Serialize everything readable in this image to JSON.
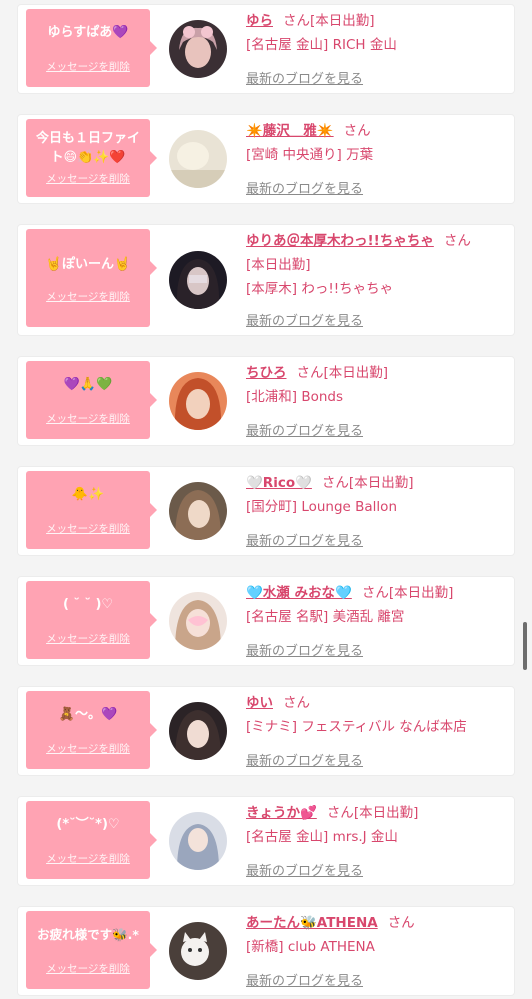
{
  "delete_label": "メッセージを削除",
  "blog_label": "最新のブログを見る",
  "san_label": "さん",
  "items": [
    {
      "message": "ゆらすぱあ💜",
      "name": "ゆら",
      "status": "[本日出勤]",
      "shop": "[名古屋 金山] RICH 金山"
    },
    {
      "message": "今日も１日ファイト😄👏✨❤️",
      "name": "✴️藤沢＿雅✴️",
      "status": "",
      "shop": "[宮崎 中央通り] 万葉"
    },
    {
      "message": "🤘ぽいーん🤘",
      "name": "ゆりあ＠本厚木わっ!!ちゃちゃ",
      "status": "[本日出勤]",
      "shop": "[本厚木] わっ!!ちゃちゃ"
    },
    {
      "message": "💜🙏💚",
      "name": "ちひろ",
      "status": "[本日出勤]",
      "shop": "[北浦和] Bonds"
    },
    {
      "message": "🐥✨",
      "name": "🤍Rico🤍",
      "status": "[本日出勤]",
      "shop": "[国分町] Lounge Ballon"
    },
    {
      "message": "( ˘ ˘ )♡",
      "name": "🩵水瀬 みおな🩵",
      "status": "[本日出勤]",
      "shop": "[名古屋 名駅] 美酒乱 離宮"
    },
    {
      "message": "🧸〜。💜",
      "name": "ゆい",
      "status": "",
      "shop": "[ミナミ] フェスティバル なんば本店"
    },
    {
      "message": "(*˘︶˘*)♡",
      "name": "きょうか💕",
      "status": "[本日出勤]",
      "shop": "[名古屋 金山] mrs.J 金山"
    },
    {
      "message": "お疲れ様です🐝.*",
      "name": "あーたん🐝ATHENA",
      "status": "",
      "shop": "[新橋] club ATHENA"
    }
  ]
}
